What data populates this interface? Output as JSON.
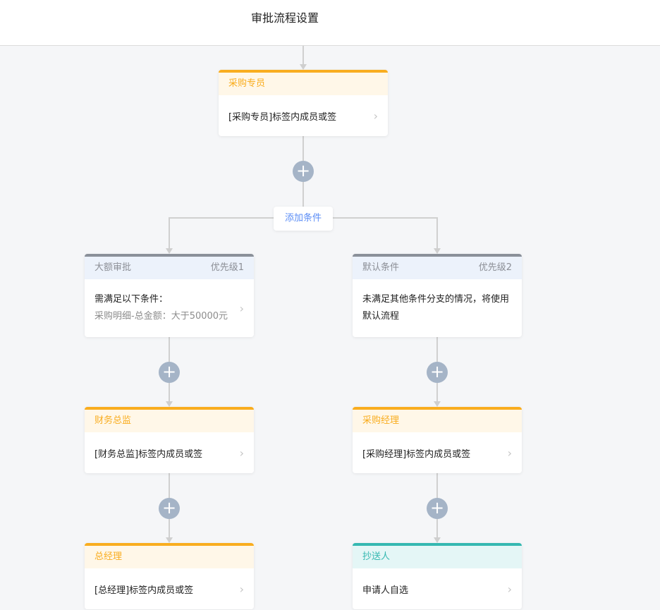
{
  "header": {
    "title": "审批流程设置"
  },
  "add_condition_label": "添加条件",
  "top_node": {
    "title": "采购专员",
    "content": "[采购专员]标签内成员或签"
  },
  "branches": [
    {
      "condition": {
        "title": "大额审批",
        "priority": "优先级1",
        "line1": "需满足以下条件：",
        "line2": "采购明细-总金额：大于50000元"
      },
      "nodes": [
        {
          "title": "财务总监",
          "content": "[财务总监]标签内成员或签"
        },
        {
          "title": "总经理",
          "content": "[总经理]标签内成员或签"
        }
      ]
    },
    {
      "condition": {
        "title": "默认条件",
        "priority": "优先级2",
        "line1": "未满足其他条件分支的情况，将使用默认流程"
      },
      "nodes": [
        {
          "title": "采购经理",
          "content": "[采购经理]标签内成员或签"
        },
        {
          "title": "抄送人",
          "content": "申请人自选"
        }
      ]
    }
  ],
  "icons": {
    "chevron": "›",
    "plus": "+"
  },
  "colors": {
    "approver": "#f9ad1f",
    "condition": "#8a9099",
    "cc": "#35b8b1",
    "add": "#5b8df6"
  }
}
